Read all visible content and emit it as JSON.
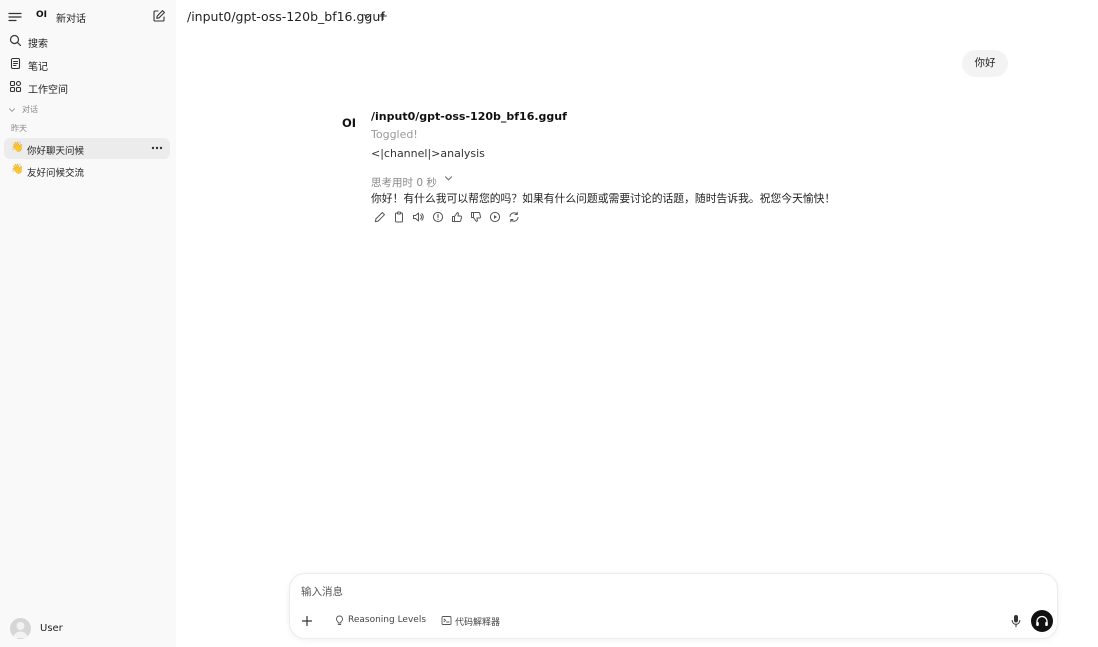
{
  "sidebar": {
    "brand": "OI",
    "new_chat": "新对话",
    "nav": [
      {
        "label": "搜索",
        "icon": "search-icon"
      },
      {
        "label": "笔记",
        "icon": "notes-icon"
      },
      {
        "label": "工作空间",
        "icon": "workspace-icon"
      }
    ],
    "section": "对话",
    "group": "昨天",
    "chats": [
      {
        "emoji": "👋",
        "label": "你好聊天问候",
        "active": true
      },
      {
        "emoji": "👋",
        "label": "友好问候交流",
        "active": false
      }
    ],
    "user": "User"
  },
  "header": {
    "model": "/input0/gpt-oss-120b_bf16.gguf",
    "add": "+"
  },
  "chat": {
    "user_message": "你好",
    "assistant": {
      "logo": "OI",
      "name": "/input0/gpt-oss-120b_bf16.gguf",
      "toggled": "Toggled!",
      "channel": "<|channel|>analysis",
      "thinking": "思考用时 0 秒",
      "reply": "你好！有什么我可以帮您的吗？如果有什么问题或需要讨论的话题，随时告诉我。祝您今天愉快！",
      "actions": [
        "edit-icon",
        "copy-icon",
        "read-aloud-icon",
        "info-icon",
        "thumbs-up-icon",
        "thumbs-down-icon",
        "continue-icon",
        "regenerate-icon"
      ]
    }
  },
  "composer": {
    "placeholder": "输入消息",
    "chips": [
      {
        "label": "Reasoning Levels",
        "icon": "lightbulb-icon"
      },
      {
        "label": "代码解释器",
        "icon": "terminal-icon"
      }
    ]
  }
}
